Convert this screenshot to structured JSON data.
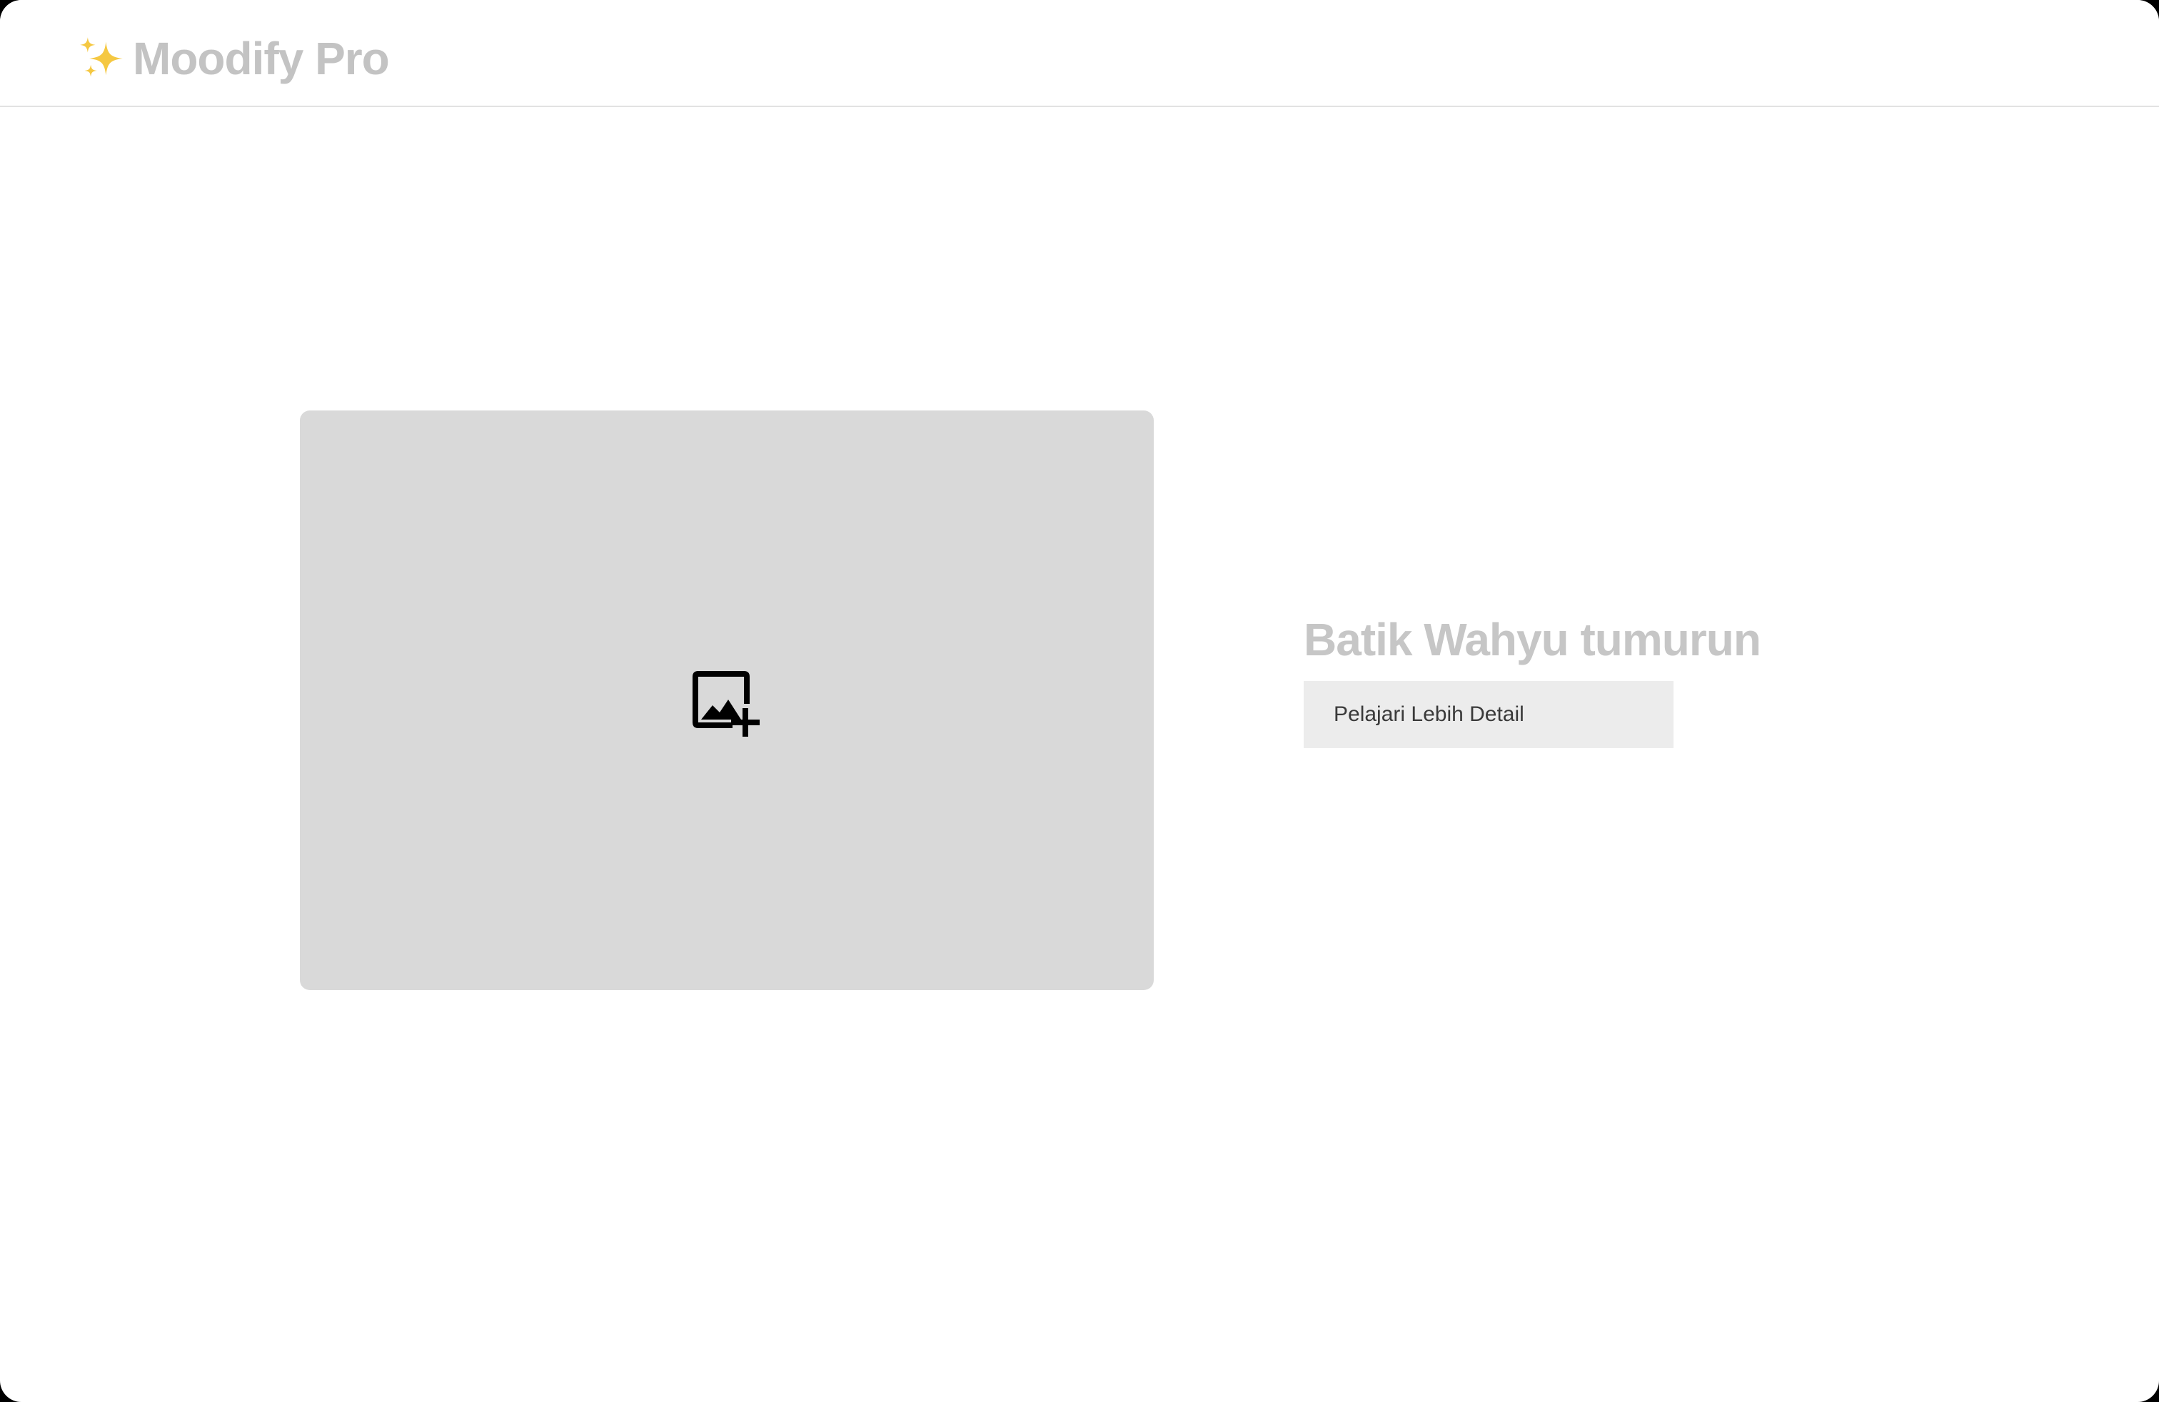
{
  "header": {
    "brand_emoji": "✨",
    "brand_name": "Moodify Pro"
  },
  "main": {
    "media_placeholder": {
      "icon": "add-photo-icon"
    },
    "product": {
      "title": "Batik Wahyu tumurun",
      "cta_label": "Pelajari Lebih Detail"
    }
  },
  "colors": {
    "background": "#ffffff",
    "brand_text": "#c3c3c3",
    "sparkle": "#f5c842",
    "placeholder_bg": "#d9d9d9",
    "title_text": "#c6c6c6",
    "button_bg": "#ececec",
    "button_text": "#3a3a3a"
  }
}
